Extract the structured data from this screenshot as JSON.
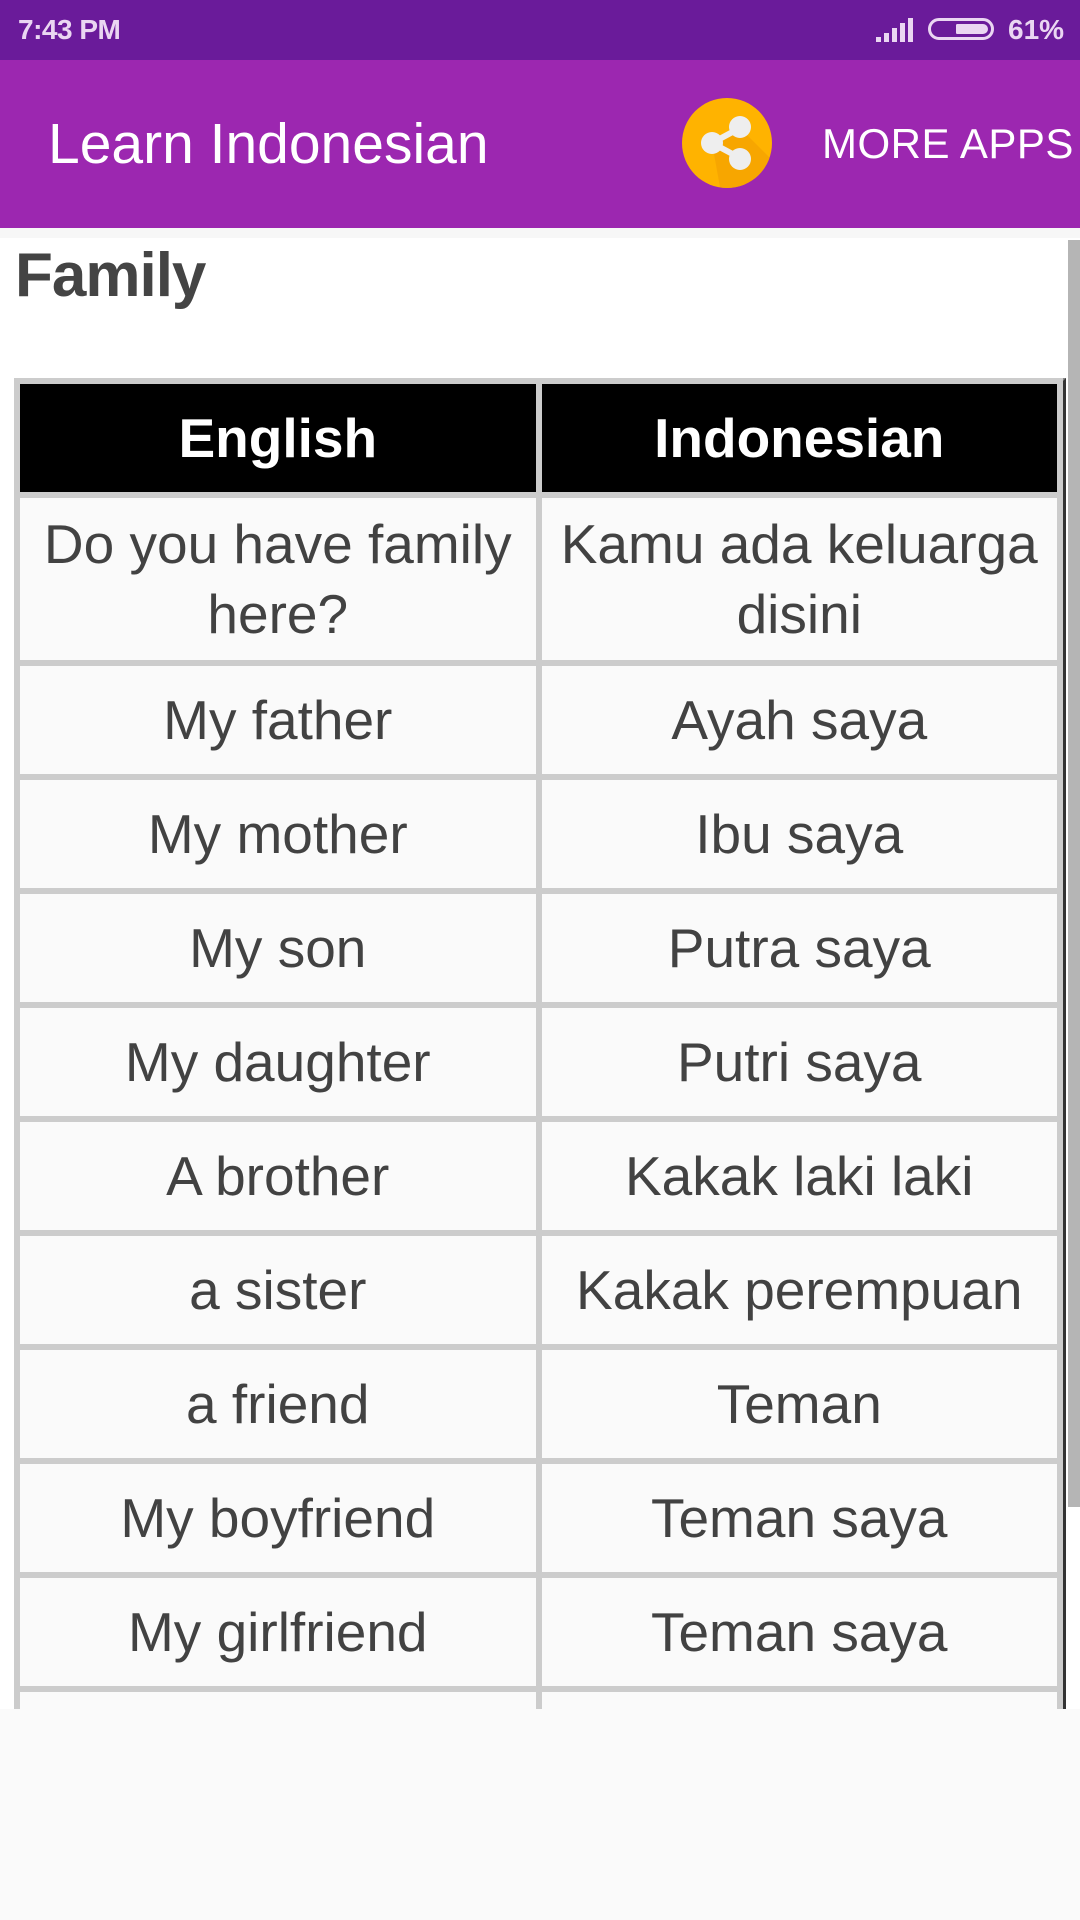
{
  "status_bar": {
    "time": "7:43 PM",
    "signal_icon": "cellular-signal-icon",
    "battery_icon": "battery-icon",
    "battery_percent": "61%",
    "battery_level": 0.61
  },
  "app_bar": {
    "title": "Learn Indonesian",
    "share_icon": "share-icon",
    "more_apps_label": "MORE APPS",
    "colors": {
      "status_bar": "#6A1B9A",
      "app_bar": "#9C27B0",
      "share_button": "#FFB300"
    }
  },
  "section": {
    "title": "Family"
  },
  "table": {
    "headers": [
      "English",
      "Indonesian"
    ],
    "rows": [
      [
        "Do you have family here?",
        "Kamu ada keluarga disini"
      ],
      [
        "My father",
        "Ayah saya"
      ],
      [
        "My mother",
        "Ibu saya"
      ],
      [
        "My son",
        "Putra saya"
      ],
      [
        "My daughter",
        "Putri saya"
      ],
      [
        "A brother",
        "Kakak laki laki"
      ],
      [
        "a sister",
        "Kakak perempuan"
      ],
      [
        "a friend",
        "Teman"
      ],
      [
        "My boyfriend",
        "Teman saya"
      ],
      [
        "My girlfriend",
        "Teman saya"
      ],
      [
        "",
        ""
      ]
    ]
  }
}
